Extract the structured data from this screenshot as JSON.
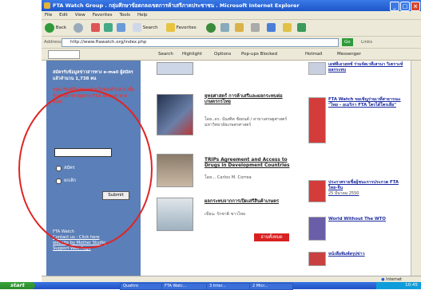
{
  "window": {
    "title": "FTA Watch Group . กลุ่มศึกษาข้อตกลงเขตการค้าเสรีภาคประชาชน . Microsoft Internet Explorer",
    "min": "_",
    "max": "□",
    "close": "×"
  },
  "menu": [
    "File",
    "Edit",
    "View",
    "Favorites",
    "Tools",
    "Help"
  ],
  "toolbar": {
    "back": "Back",
    "search": "Search",
    "favorites": "Favorites"
  },
  "address": {
    "label": "Address",
    "url": "http://www.ftawatch.org/index.php",
    "go": "Go",
    "links": "Links"
  },
  "linksbar": {
    "search": "Search",
    "highlight": "Highlight",
    "options": "Options",
    "popups": "Pop-ups Blocked",
    "hotmail": "Hotmail",
    "messenger": "Messenger"
  },
  "left": {
    "intro": "สมัครรับข้อมูลข่าวสารทาง e-mail ผู้สมัครแล้วจำนวน 1,738 คน",
    "note": "กรุณาพิมพ์อีเมลของท่านในช่องด้านล่าง เพื่อรับข่าวสารล่าสุดจาก FTA Watch ทางอีเมล",
    "radio1": "สมัคร",
    "radio2": "ยกเลิก",
    "submit": "Submit",
    "footer1": "FTA Watch",
    "footer2": "Contact us : Click here",
    "footer3": "website by Mother Studio",
    "footer4": "Support Web Page"
  },
  "middle": {
    "item1_title": "ยุทธศาสตร์ การค้าเสรีและผลกระทบต่อเกษตรกรไทย",
    "item1_sub": "โดย..ดร. บัณฑิต ชัยยนต์ / สาขาเศรษฐศาสตร์ มหาวิทยาลัยเกษตรศาสตร์",
    "item2_title": "TRIPs Agreement and Access to Drugs in Development Countries",
    "item2_sub": "โดย... Carlos M. Correa",
    "item3_title": "ผลกระทบจากการเปิดเสรีสินค้าเกษตร",
    "item3_sub": "เขียน: รักชาติ ชาวไทย",
    "readall": "อ่านทั้งหมด"
  },
  "right": {
    "item0": "เอฟทีเอวอทช์ ร่วมจัดเวทีเสวนา วิเคราะห์ผลกระทบ",
    "item1": "FTA Watch ขอเชิญร่วมเวทีสาธารณะ \"ไทย - อเมริกา FTA ใครได้ใครเสีย\"",
    "item2": "ประกาศรายชื่อผู้ชนะการประกวด FTA ไทย-จีน",
    "item2_date": "25 มีนาคม 2550",
    "item3": "World Without The WTO",
    "item4": "หนังสือพิมพ์สรุปข่าว"
  },
  "status": {
    "zone": "Internet"
  },
  "taskbar": {
    "start": "start",
    "tasks": [
      "Quattro",
      "FTA Watc...",
      "3 Inter...",
      "2 Micr..."
    ],
    "time": "10:45"
  },
  "colors": {
    "accent": "#2b5fd6",
    "left_panel": "#5b7fb8",
    "annotation_circle": "#e02424",
    "readall": "#d92020"
  }
}
